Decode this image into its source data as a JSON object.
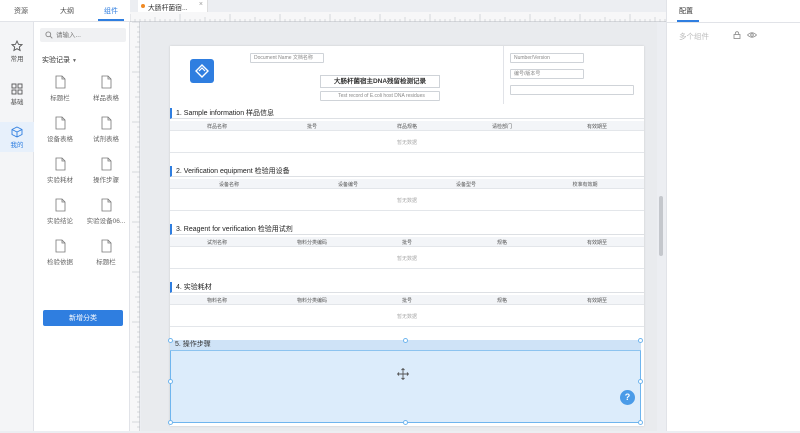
{
  "left_tabs": [
    "资源",
    "大纲",
    "组件"
  ],
  "icon_bar": [
    {
      "icon": "star-icon",
      "label": "常用"
    },
    {
      "icon": "grid-icon",
      "label": "基础"
    },
    {
      "icon": "cube-icon",
      "label": "我的"
    }
  ],
  "search": {
    "placeholder": "请输入..."
  },
  "category": "实验记录",
  "components": [
    {
      "label": "标题栏"
    },
    {
      "label": "样品表格"
    },
    {
      "label": "设备表格"
    },
    {
      "label": "试剂表格"
    },
    {
      "label": "实验耗材"
    },
    {
      "label": "操作步骤"
    },
    {
      "label": "实验结论"
    },
    {
      "label": "实验设备06..."
    },
    {
      "label": "检验依据"
    },
    {
      "label": "标题栏"
    }
  ],
  "add_category_label": "新增分类",
  "doc_tab": {
    "title": "大肠杆菌宿...",
    "close": "×"
  },
  "header": {
    "doc_name": "Document Name 文档名称",
    "title": "大肠杆菌宿主DNA残留检测记录",
    "subtitle": "Test record of E.coli host DNA residues",
    "number_version": "Number/Version",
    "number_version_cn": "编号/版本号"
  },
  "sections": [
    {
      "title": "1. Sample information 样品信息",
      "columns": [
        "样品名称",
        "批号",
        "样品规格",
        "请检部门",
        "有效期至"
      ],
      "empty": "暂无数据"
    },
    {
      "title": "2. Verification equipment 检验用设备",
      "columns": [
        "设备名称",
        "设备编号",
        "设备型号",
        "校准有效期"
      ],
      "empty": "暂无数据"
    },
    {
      "title": "3. Reagent for verification 检验用试剂",
      "columns": [
        "试剂名称",
        "物料分类编码",
        "批号",
        "规格",
        "有效期至"
      ],
      "empty": "暂无数据"
    },
    {
      "title": "4. 实验耗材",
      "columns": [
        "物料名称",
        "物料分类编码",
        "批号",
        "规格",
        "有效期至"
      ],
      "empty": "暂无数据"
    }
  ],
  "selected_section": {
    "title": "5. 操作步骤"
  },
  "help_label": "?",
  "right_panel": {
    "tab": "配置",
    "multi": "多个组件"
  },
  "colors": {
    "accent": "#2f7ee0",
    "selection": "#dcecfb"
  }
}
